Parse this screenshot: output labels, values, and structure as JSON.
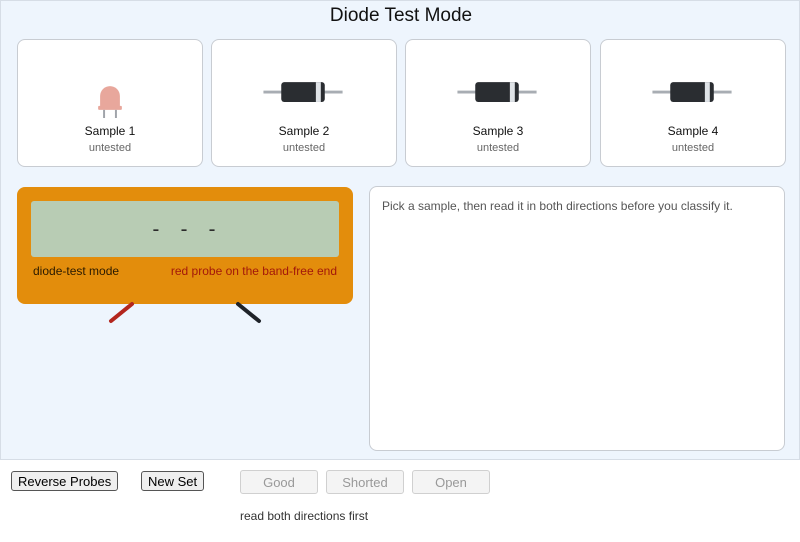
{
  "header": {
    "title": "Diode Test Mode"
  },
  "samples": [
    {
      "name": "Sample 1",
      "status": "untested",
      "icon": "led-icon"
    },
    {
      "name": "Sample 2",
      "status": "untested",
      "icon": "diode-icon"
    },
    {
      "name": "Sample 3",
      "status": "untested",
      "icon": "diode-icon"
    },
    {
      "name": "Sample 4",
      "status": "untested",
      "icon": "diode-icon"
    }
  ],
  "meter": {
    "display": "- - -",
    "mode_label": "diode-test mode",
    "probe_hint": "red probe on the band-free end",
    "colors": {
      "body": "#e38d0c",
      "lcd": "#b8ccb4",
      "red_probe": "#b3261e",
      "black_probe": "#1f2329"
    }
  },
  "panel": {
    "message": "Pick a sample, then read it in both directions before you classify it."
  },
  "controls": {
    "reverse_label": "Reverse Probes",
    "new_set_label": "New Set",
    "classify": {
      "good": "Good",
      "shorted": "Shorted",
      "open": "Open"
    },
    "footnote": "read both directions first"
  }
}
